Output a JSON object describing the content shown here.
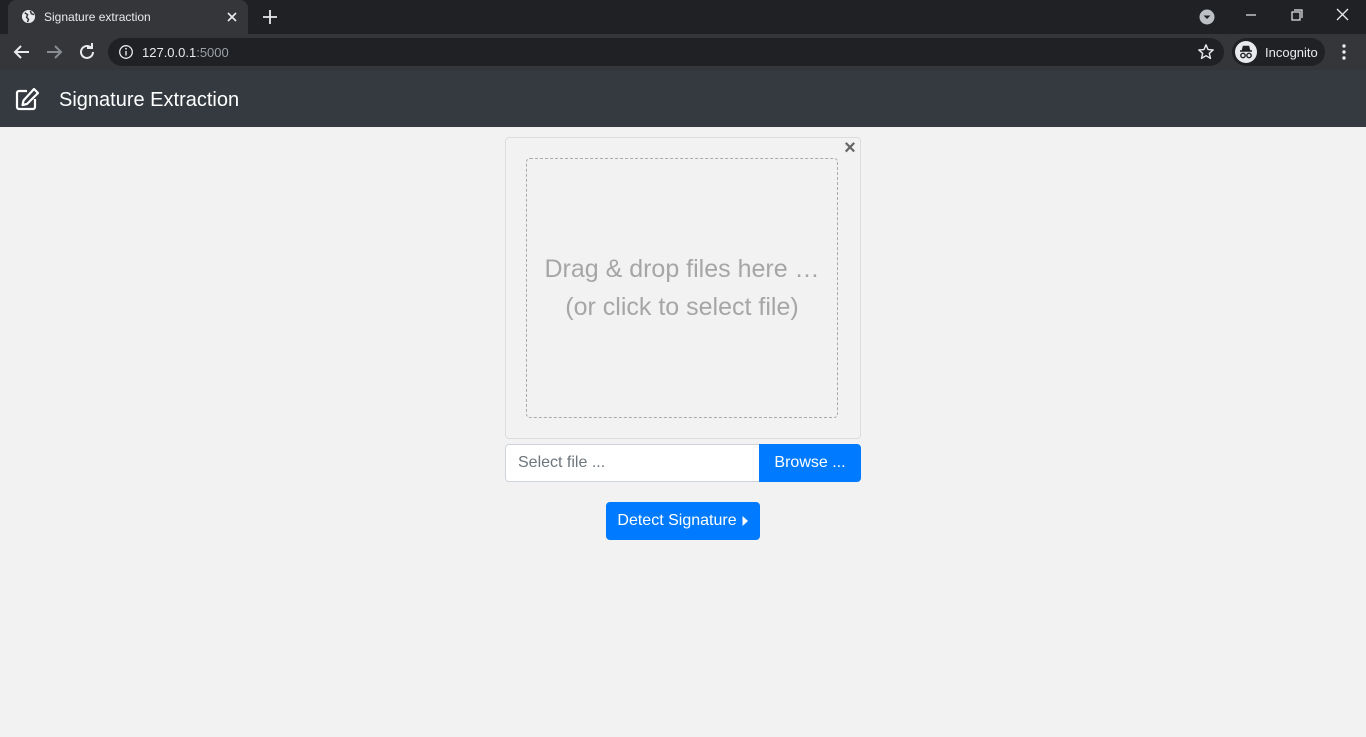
{
  "browser": {
    "tab_title": "Signature extraction",
    "url_host": "127.0.0.1",
    "url_port": ":5000",
    "profile_label": "Incognito"
  },
  "navbar": {
    "brand_icon": "edit-icon",
    "title": "Signature Extraction"
  },
  "uploader": {
    "drop_line1": "Drag & drop files here …",
    "drop_line2": "(or click to select file)",
    "remove_icon": "close-icon",
    "caption_placeholder": "Select file ...",
    "browse_label": "Browse ..."
  },
  "actions": {
    "detect_label": "Detect Signature",
    "detect_icon": "caret-right-icon"
  },
  "colors": {
    "primary": "#007bff",
    "navbar": "#343a40",
    "page_bg": "#f2f2f2"
  }
}
